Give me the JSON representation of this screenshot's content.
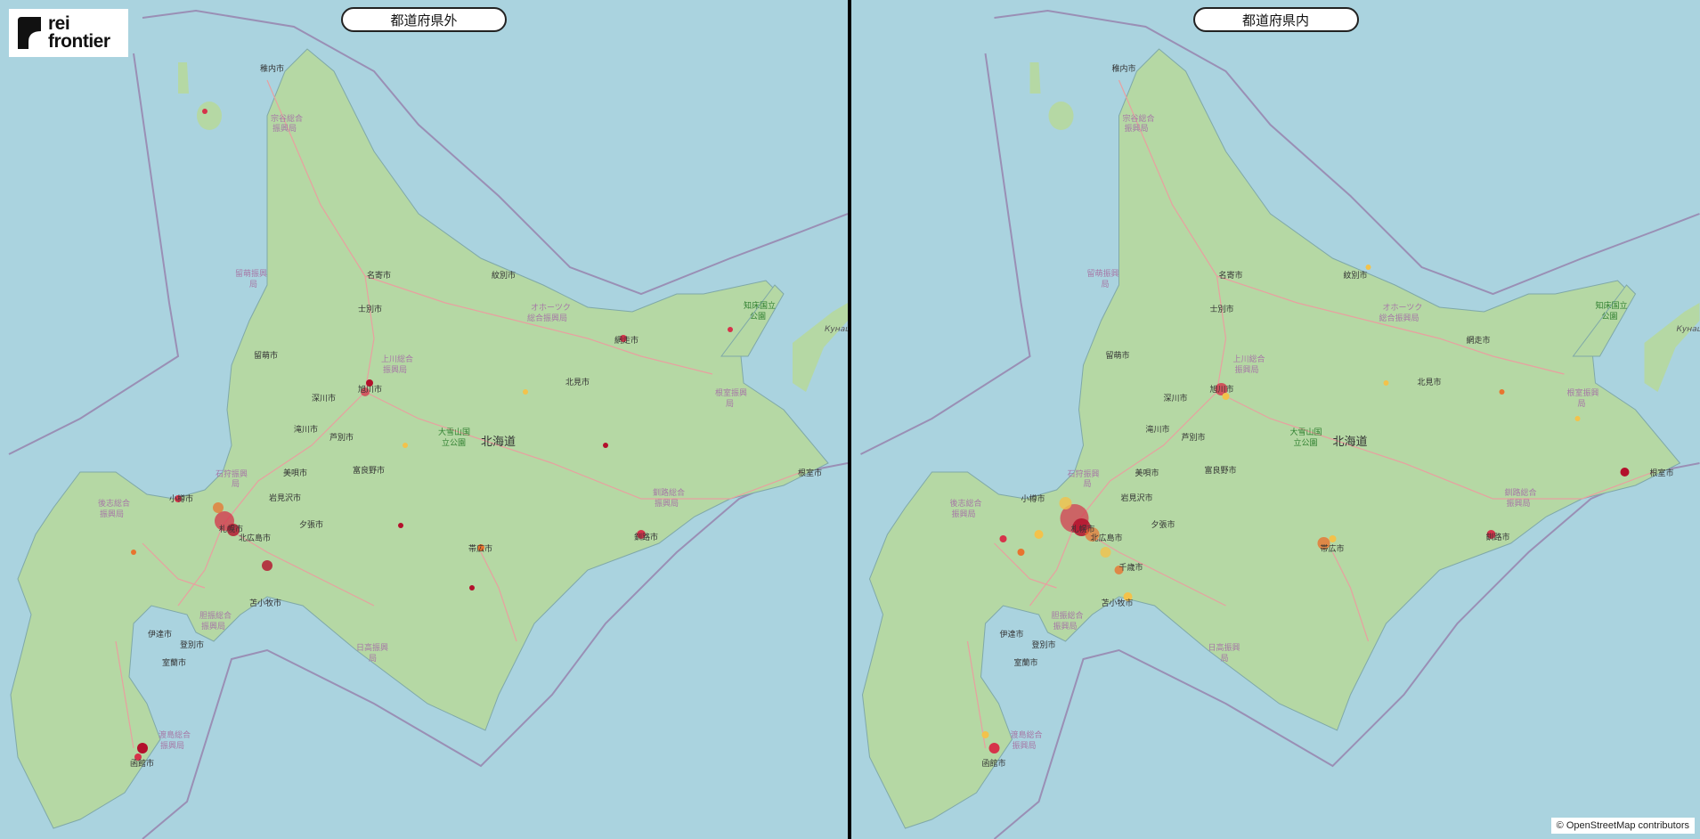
{
  "logo": {
    "line1": "rei",
    "line2": "frontier"
  },
  "attribution": "© OpenStreetMap contributors",
  "colors": {
    "sea": "#aad3df",
    "land": "#b5d8a4",
    "road": "#e8a0a0",
    "boundary": "#9a8fb5",
    "heat_low": "#f3c24b",
    "heat_high": "#b3102b"
  },
  "panels": [
    {
      "title": "都道府県外",
      "prefecture": "北海道",
      "park": [
        "大雪山国",
        "立公園"
      ],
      "park2": [
        "知床国立",
        "公園"
      ],
      "cities": [
        "稚内市",
        "名寄市",
        "紋別市",
        "士別市",
        "留萌市",
        "網走市",
        "北見市",
        "旭川市",
        "深川市",
        "滝川市",
        "芦別市",
        "美唄市",
        "富良野市",
        "岩見沢市",
        "夕張市",
        "小樽市",
        "札幌市",
        "北広島市",
        "苫小牧市",
        "伊達市",
        "登別市",
        "室蘭市",
        "帯広市",
        "釧路市",
        "根室市",
        "函館市"
      ],
      "regions": [
        "宗谷総合",
        "振興局",
        "オホーツク",
        "総合振興局",
        "上川総合",
        "振興局",
        "留萌振興",
        "局",
        "石狩振興",
        "局",
        "後志総合",
        "振興局",
        "胆振総合",
        "振興局",
        "日高振興",
        "局",
        "釧路総合",
        "振興局",
        "根室振興",
        "局",
        "渡島総合",
        "振興局"
      ],
      "foreign": "Кунаш"
    },
    {
      "title": "都道府県内",
      "prefecture": "北海道",
      "park": [
        "大雪山国",
        "立公園"
      ],
      "park2": [
        "知床国立",
        "公園"
      ],
      "cities": [
        "稚内市",
        "名寄市",
        "紋別市",
        "士別市",
        "留萌市",
        "網走市",
        "北見市",
        "旭川市",
        "深川市",
        "滝川市",
        "芦別市",
        "美唄市",
        "富良野市",
        "岩見沢市",
        "夕張市",
        "小樽市",
        "札幌市",
        "北広島市",
        "千歳市",
        "苫小牧市",
        "伊達市",
        "登別市",
        "室蘭市",
        "帯広市",
        "釧路市",
        "根室市",
        "函館市"
      ],
      "regions": [
        "宗谷総合",
        "振興局",
        "オホーツク",
        "総合振興局",
        "上川総合",
        "振興局",
        "留萌振興",
        "局",
        "石狩振興",
        "局",
        "後志総合",
        "振興局",
        "胆振総合",
        "振興局",
        "日高振興",
        "局",
        "釧路総合",
        "振興局",
        "根室振興",
        "局",
        "渡島総合",
        "振興局"
      ],
      "foreign": "Кунаш"
    }
  ]
}
